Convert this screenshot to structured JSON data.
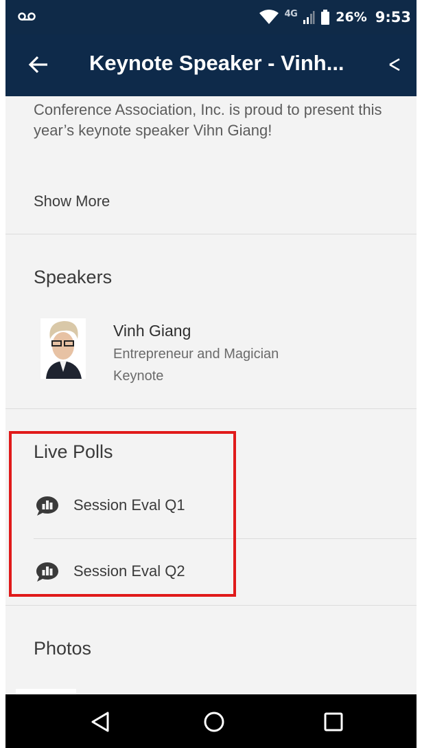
{
  "status_bar": {
    "network": "4G",
    "battery": "26%",
    "time": "9:53"
  },
  "app_bar": {
    "title": "Keynote Speaker - Vinh..."
  },
  "description": {
    "text": "Conference  Association, Inc. is proud to present this year’s keynote speaker Vihn Giang!",
    "show_more": "Show More"
  },
  "speakers": {
    "title": "Speakers",
    "items": [
      {
        "name": "Vinh Giang",
        "role": "Entrepreneur and Magician",
        "type": "Keynote"
      }
    ]
  },
  "live_polls": {
    "title": "Live Polls",
    "items": [
      {
        "label": "Session Eval Q1",
        "icon": "poll-chat-icon"
      },
      {
        "label": "Session Eval Q2",
        "icon": "poll-chat-icon"
      }
    ]
  },
  "photos": {
    "title": "Photos"
  },
  "colors": {
    "app_bar": "#0e2a4a",
    "background": "#f3f3f3",
    "highlight": "#e01a1a"
  }
}
